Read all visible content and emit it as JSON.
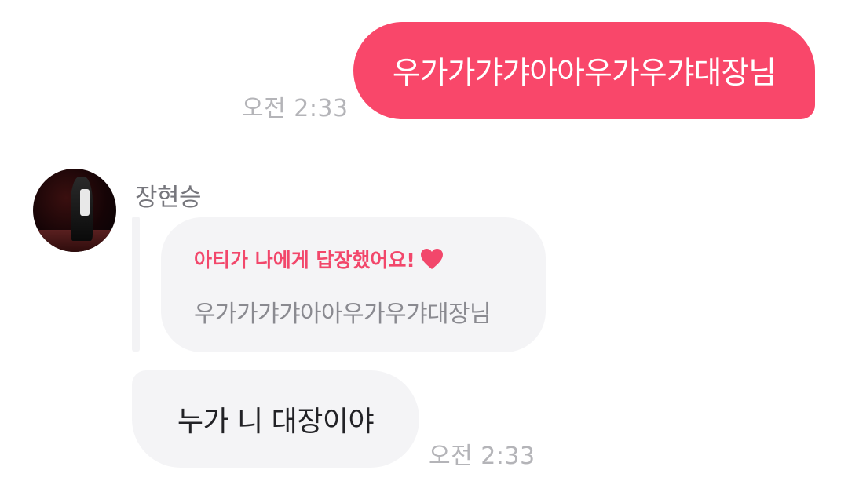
{
  "messages": {
    "sent": {
      "text": "우가가갸갸아아우가우갸대장님",
      "time": "오전 2:33"
    },
    "received": {
      "sender_name": "장현승",
      "reply_card": {
        "header": "아티가 나에게 답장했어요!",
        "quoted_text": "우가가갸갸아아우가우갸대장님",
        "icon": "heart-icon"
      },
      "text": "누가 니 대장이야",
      "time": "오전 2:33"
    }
  },
  "colors": {
    "sent_bubble": "#f9476a",
    "received_bubble": "#f4f4f6",
    "accent": "#f2476b",
    "timestamp": "#b4b4b8"
  }
}
